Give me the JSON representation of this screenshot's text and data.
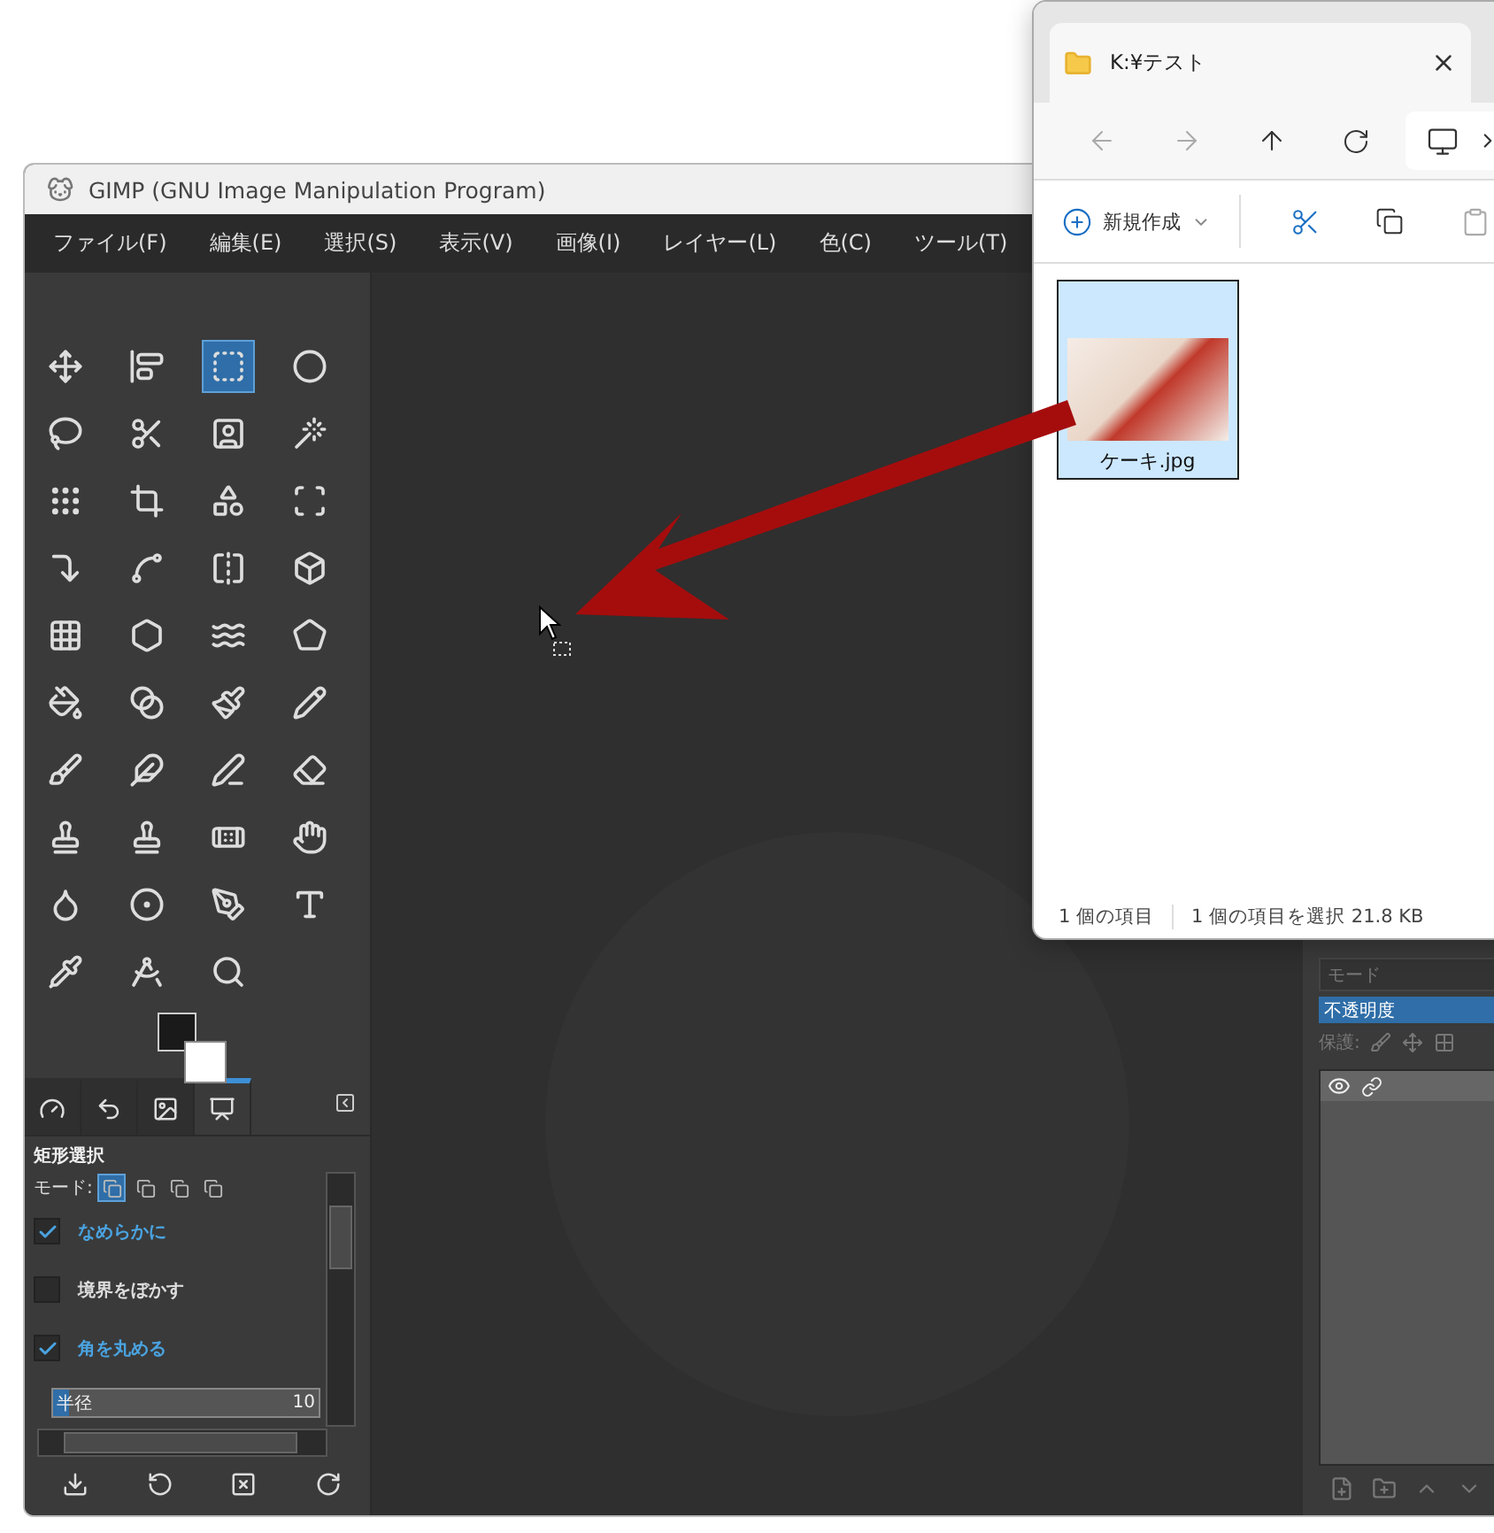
{
  "gimp": {
    "title": "GIMP (GNU Image Manipulation Program)",
    "menu": [
      "ファイル(F)",
      "編集(E)",
      "選択(S)",
      "表示(V)",
      "画像(I)",
      "レイヤー(L)",
      "色(C)",
      "ツール(T)"
    ],
    "tools": [
      {
        "kind": "move",
        "selected": false
      },
      {
        "kind": "align",
        "selected": false
      },
      {
        "kind": "rect",
        "selected": true
      },
      {
        "kind": "ellipse",
        "selected": false
      },
      {
        "kind": "lasso",
        "selected": false
      },
      {
        "kind": "scissors",
        "selected": false
      },
      {
        "kind": "foreground",
        "selected": false
      },
      {
        "kind": "wand",
        "selected": false
      },
      {
        "kind": "bycolor",
        "selected": false
      },
      {
        "kind": "crop",
        "selected": false
      },
      {
        "kind": "transform",
        "selected": false
      },
      {
        "kind": "handle",
        "selected": false
      },
      {
        "kind": "flip",
        "selected": false
      },
      {
        "kind": "shear",
        "selected": false
      },
      {
        "kind": "scale",
        "selected": false
      },
      {
        "kind": "cube",
        "selected": false
      },
      {
        "kind": "grid",
        "selected": false
      },
      {
        "kind": "cage",
        "selected": false
      },
      {
        "kind": "warp",
        "selected": false
      },
      {
        "kind": "perspective",
        "selected": false
      },
      {
        "kind": "bucket",
        "selected": false
      },
      {
        "kind": "gradient",
        "selected": false
      },
      {
        "kind": "brush",
        "selected": false
      },
      {
        "kind": "pencil",
        "selected": false
      },
      {
        "kind": "airbrush",
        "selected": false
      },
      {
        "kind": "ink",
        "selected": false
      },
      {
        "kind": "mypaint",
        "selected": false
      },
      {
        "kind": "eraser",
        "selected": false
      },
      {
        "kind": "clone",
        "selected": false
      },
      {
        "kind": "heal",
        "selected": false
      },
      {
        "kind": "bandage",
        "selected": false
      },
      {
        "kind": "smudge",
        "selected": false
      },
      {
        "kind": "blur",
        "selected": false
      },
      {
        "kind": "dodge",
        "selected": false
      },
      {
        "kind": "paths",
        "selected": false
      },
      {
        "kind": "text",
        "selected": false
      },
      {
        "kind": "picker",
        "selected": false
      },
      {
        "kind": "measure",
        "selected": false
      },
      {
        "kind": "zoom",
        "selected": false
      }
    ],
    "dock_tabs": [
      {
        "kind": "device",
        "selected": false
      },
      {
        "kind": "undo",
        "selected": false
      },
      {
        "kind": "images",
        "selected": false
      },
      {
        "kind": "options",
        "selected": true
      }
    ],
    "tool_options": {
      "title": "矩形選択",
      "mode_label": "モード:",
      "modes": [
        {
          "selected": true
        },
        {
          "selected": false
        },
        {
          "selected": false
        },
        {
          "selected": false
        }
      ],
      "options": [
        {
          "label": "なめらかに",
          "checked": true
        },
        {
          "label": "境界をぼかす",
          "checked": false
        },
        {
          "label": "角を丸める",
          "checked": true
        }
      ],
      "radius": {
        "label": "半径",
        "value": "10",
        "level": 0.06
      }
    },
    "layers": {
      "mode_label": "モード",
      "opacity": {
        "label": "不透明度",
        "level": 1
      },
      "lock_label": "保護:"
    }
  },
  "explorer": {
    "tab_title": "K:¥テスト",
    "new_label": "新規作成",
    "files": [
      {
        "name": "ケーキ.jpg",
        "selected": true
      }
    ],
    "status": [
      "1 個の項目",
      "1 個の項目を選択  21.8 KB"
    ]
  }
}
